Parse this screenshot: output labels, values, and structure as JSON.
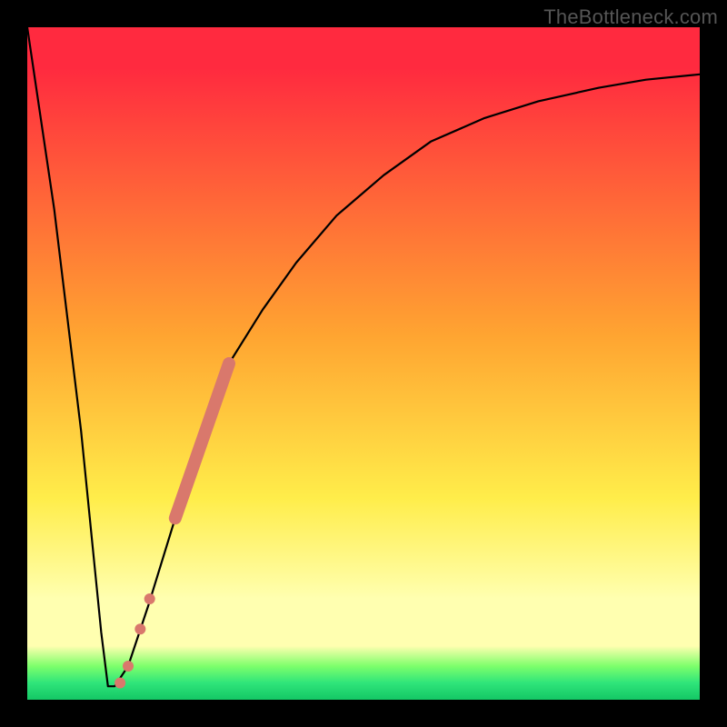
{
  "watermark": "TheBottleneck.com",
  "colors": {
    "red": "#ff2a3f",
    "orange": "#ffa531",
    "yellow": "#ffed4a",
    "paleyellow": "#ffffb0",
    "bright_green": "#7dff6b",
    "green": "#2fe57a",
    "dark_green": "#14c765",
    "curve": "#000000",
    "marker": "#d9786c"
  },
  "chart_data": {
    "type": "line",
    "title": "",
    "xlabel": "",
    "ylabel": "",
    "xlim": [
      0,
      100
    ],
    "ylim": [
      0,
      100
    ],
    "grid": false,
    "legend": false,
    "annotations": [
      "TheBottleneck.com"
    ],
    "series": [
      {
        "name": "bottleneck-curve",
        "x": [
          0,
          4,
          8,
          11,
          12,
          13,
          15,
          18,
          22,
          26,
          30,
          35,
          40,
          46,
          53,
          60,
          68,
          76,
          85,
          92,
          100
        ],
        "y": [
          100,
          73,
          40,
          10,
          2,
          2,
          5,
          14,
          27,
          40,
          50,
          58,
          65,
          72,
          78,
          83,
          86.5,
          89,
          91,
          92.2,
          93
        ]
      }
    ],
    "markers": {
      "name": "highlighted-range",
      "shape": "circle",
      "color": "#d9786c",
      "segment": {
        "x0": 22,
        "y0": 27,
        "x1": 30,
        "y1": 50
      },
      "points": [
        {
          "x": 18.2,
          "y": 15.0,
          "r": 6
        },
        {
          "x": 16.8,
          "y": 10.5,
          "r": 6
        },
        {
          "x": 15.0,
          "y": 5.0,
          "r": 6
        },
        {
          "x": 13.8,
          "y": 2.5,
          "r": 6
        }
      ]
    }
  }
}
